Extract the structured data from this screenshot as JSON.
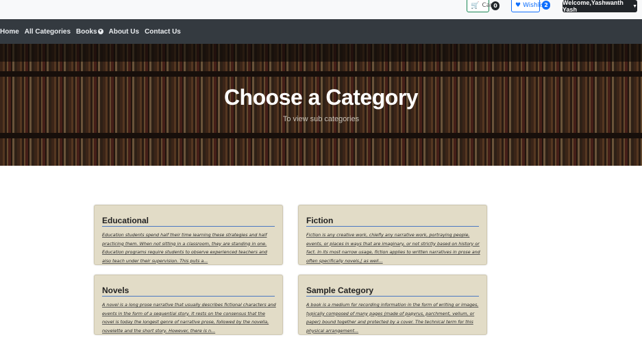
{
  "topbar": {
    "cart_label": "Cart",
    "cart_count": "0",
    "wishlist_label": "Wishlist",
    "wishlist_count": "2",
    "welcome_label": "Welcome,Yashwanth Yash"
  },
  "nav": {
    "items": [
      "Home",
      "All Categories",
      "Books",
      "About Us",
      "Contact Us"
    ]
  },
  "hero": {
    "title": "Choose a Category",
    "subtitle": "To view sub categories"
  },
  "cards": [
    {
      "title": "Educational",
      "text": "Education students spend half their time learning these strategies and half practicing them. When not sitting in a classroom, they are standing in one. Education programs require students to observe experienced teachers and also teach under their supervision. This puts a..."
    },
    {
      "title": "Fiction",
      "text": "Fiction is any creative work, chiefly any narrative work, portraying people, events, or places in ways that are imaginary, or not strictly based on history or fact. In its most narrow usage, fiction applies to written narratives in prose and often specifically novels,[ as well..."
    },
    {
      "title": "Novels",
      "text": "A novel is a long prose narrative that usually describes fictional characters and events in the form of a sequential story. It rests on the consensus that the novel is today the longest genre of narrative prose, followed by the novella, novelette and the short story. However, there is n..."
    },
    {
      "title": "Sample Category",
      "text": "A book is a medium for recording information in the form of writing or images, typically composed of many pages (made of papyrus, parchment, vellum, or paper) bound together and protected by a cover. The technical term for this physical arrangement..."
    }
  ],
  "colors": {
    "navbar": "#343a40",
    "card_bg": "#e2dcc7",
    "title_underline": "#4a78c2",
    "cart_accent": "#198754",
    "wishlist_accent": "#0d6efd"
  },
  "icons": {
    "cart": "cart-icon",
    "wishlist": "heart-icon",
    "dropdown": "chevron-down-icon"
  }
}
